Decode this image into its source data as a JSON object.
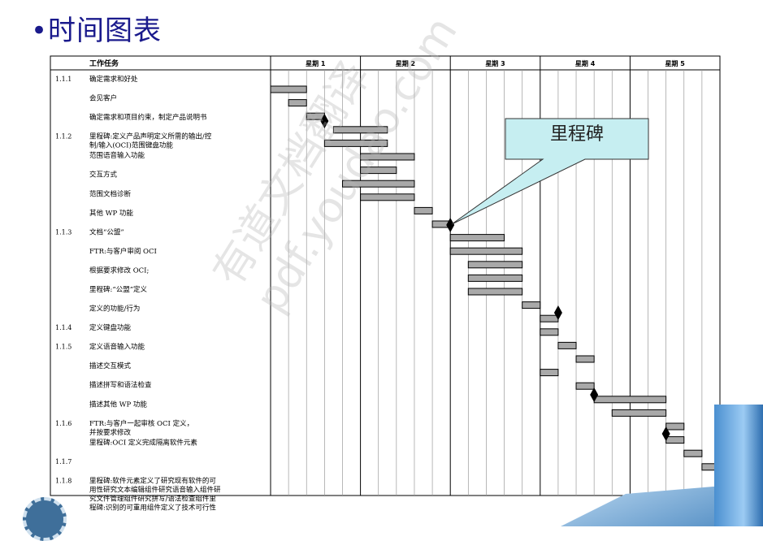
{
  "page": {
    "title": "•时间图表",
    "callout": "里程碑",
    "watermark_lines": [
      "有道文档翻译",
      "pdf.youdao.com"
    ]
  },
  "colors": {
    "title": "#1a1a8c",
    "bar": "#a9a9a9",
    "callout_fill": "#c6eef1",
    "milestone": "#000000"
  },
  "chart_data": {
    "type": "gantt",
    "task_header": "工作任务",
    "weeks": [
      "星期 1",
      "星期 2",
      "星期 3",
      "星期 4",
      "星期 5"
    ],
    "days_per_week": 5,
    "rows": [
      {
        "id": "1.1.1",
        "task": "确定需求和好处"
      },
      {
        "id": "",
        "task": "会见客户"
      },
      {
        "id": "",
        "task": "确定需求和项目约束，制定产品说明书"
      },
      {
        "id": "1.1.2",
        "task": "里程碑:定义产品声明定义所需的输出/控制/输入(OCI)范围键盘功能"
      },
      {
        "id": "",
        "task": "范围语音输入功能"
      },
      {
        "id": "",
        "task": "交互方式"
      },
      {
        "id": "",
        "task": "范围文档诊断"
      },
      {
        "id": "",
        "task": "其他 WP 功能"
      },
      {
        "id": "1.1.3",
        "task": "文档“公盟”"
      },
      {
        "id": "",
        "task": "FTR:与客户审阅 OCI"
      },
      {
        "id": "",
        "task": "根据要求修改 OCI;"
      },
      {
        "id": "",
        "task": "里程碑:“公盟”定义"
      },
      {
        "id": "",
        "task": "定义的功能/行为"
      },
      {
        "id": "1.1.4",
        "task": "定义键盘功能"
      },
      {
        "id": "1.1.5",
        "task": "定义语音输入功能"
      },
      {
        "id": "",
        "task": "描述交互模式"
      },
      {
        "id": "",
        "task": "描述拼写和语法检查"
      },
      {
        "id": "",
        "task": "描述其他 WP 功能"
      },
      {
        "id": "1.1.6",
        "task": "FTR:与客户一起审核 OCI 定义，并按要求修改"
      },
      {
        "id": "",
        "task": "里程碑:OCI 定义完成隔离软件元素"
      },
      {
        "id": "1.1.7",
        "task": ""
      },
      {
        "id": "1.1.8",
        "task": "里程碑:软件元素定义了研究现有软件的可用性研究文本编辑组件研究语音输入组件研究文件管理组件研究拼写/语法检查组件里程碑:识别的可重用组件定义了技术可行性"
      }
    ],
    "bars": [
      {
        "start": 0.0,
        "end": 2.0
      },
      {
        "start": 1.0,
        "end": 2.0
      },
      {
        "start": 2.0,
        "end": 3.0
      },
      {
        "start": 3.5,
        "end": 6.5
      },
      {
        "start": 3.0,
        "end": 6.5
      },
      {
        "start": 5.0,
        "end": 8.0
      },
      {
        "start": 5.0,
        "end": 7.0
      },
      {
        "start": 4.0,
        "end": 8.0
      },
      {
        "start": 5.0,
        "end": 8.0
      },
      {
        "start": 8.0,
        "end": 9.0
      },
      {
        "start": 9.0,
        "end": 10.0
      },
      {
        "start": 10.0,
        "end": 13.0
      },
      {
        "start": 10.0,
        "end": 14.0
      },
      {
        "start": 11.0,
        "end": 14.0
      },
      {
        "start": 11.0,
        "end": 14.0
      },
      {
        "start": 11.0,
        "end": 14.0
      },
      {
        "start": 14.0,
        "end": 15.0
      },
      {
        "start": 15.0,
        "end": 16.0
      },
      {
        "start": 15.0,
        "end": 16.0
      },
      {
        "start": 16.0,
        "end": 17.0
      },
      {
        "start": 17.0,
        "end": 18.0
      },
      {
        "start": 15.0,
        "end": 16.0
      },
      {
        "start": 17.0,
        "end": 18.0
      },
      {
        "start": 18.0,
        "end": 22.0
      },
      {
        "start": 19.0,
        "end": 22.0
      },
      {
        "start": 22.0,
        "end": 23.0
      },
      {
        "start": 22.0,
        "end": 23.0
      },
      {
        "start": 23.0,
        "end": 24.0
      },
      {
        "start": 24.0,
        "end": 25.0
      }
    ],
    "milestones": [
      3.0,
      10.0,
      16.0,
      18.0,
      22.0,
      25.0
    ]
  }
}
